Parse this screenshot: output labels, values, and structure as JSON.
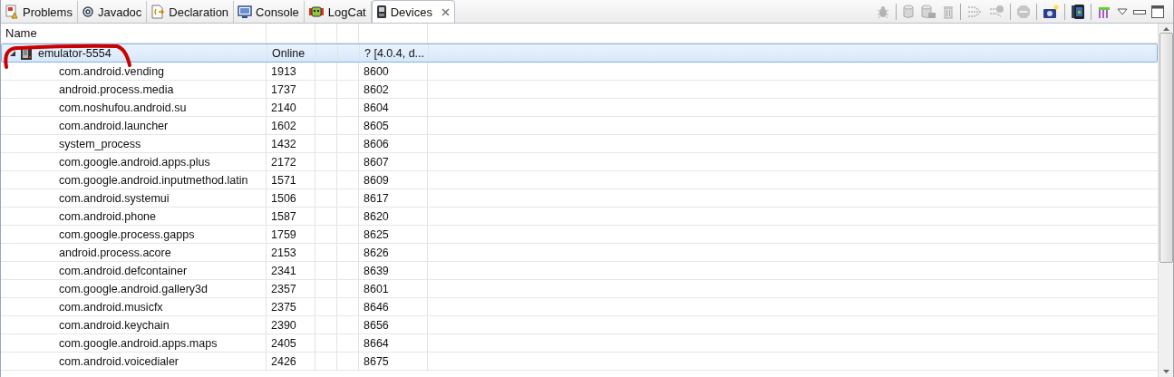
{
  "tabs": [
    {
      "label": "Problems",
      "kind": "problems",
      "selected": false
    },
    {
      "label": "Javadoc",
      "kind": "at",
      "selected": false
    },
    {
      "label": "Declaration",
      "kind": "declaration",
      "selected": false
    },
    {
      "label": "Console",
      "kind": "console",
      "selected": false
    },
    {
      "label": "LogCat",
      "kind": "logcat",
      "selected": false
    },
    {
      "label": "Devices",
      "kind": "phone",
      "selected": true
    }
  ],
  "toolbar": [
    {
      "kind": "bug",
      "disabled": true
    },
    {
      "kind": "sep"
    },
    {
      "kind": "heap",
      "disabled": true
    },
    {
      "kind": "dump",
      "disabled": true
    },
    {
      "kind": "gc",
      "disabled": true
    },
    {
      "kind": "sep"
    },
    {
      "kind": "threads",
      "disabled": true
    },
    {
      "kind": "alloc",
      "disabled": true
    },
    {
      "kind": "sep"
    },
    {
      "kind": "stop",
      "disabled": true
    },
    {
      "kind": "sep"
    },
    {
      "kind": "camera",
      "disabled": false
    },
    {
      "kind": "sep"
    },
    {
      "kind": "device",
      "disabled": false
    },
    {
      "kind": "sep"
    },
    {
      "kind": "trace",
      "disabled": false
    }
  ],
  "table": {
    "columns": [
      "Name"
    ],
    "device": {
      "name": "emulator-5554",
      "expanded": true,
      "selected": true,
      "status": "Online",
      "column_5": "? [4.0.4, d..."
    },
    "rows": [
      {
        "name": "com.android.vending",
        "pid": "1913",
        "port": "8600"
      },
      {
        "name": "android.process.media",
        "pid": "1737",
        "port": "8602"
      },
      {
        "name": "com.noshufou.android.su",
        "pid": "2140",
        "port": "8604"
      },
      {
        "name": "com.android.launcher",
        "pid": "1602",
        "port": "8605"
      },
      {
        "name": "system_process",
        "pid": "1432",
        "port": "8606"
      },
      {
        "name": "com.google.android.apps.plus",
        "pid": "2172",
        "port": "8607"
      },
      {
        "name": "com.google.android.inputmethod.latin",
        "pid": "1571",
        "port": "8609"
      },
      {
        "name": "com.android.systemui",
        "pid": "1506",
        "port": "8617"
      },
      {
        "name": "com.android.phone",
        "pid": "1587",
        "port": "8620"
      },
      {
        "name": "com.google.process.gapps",
        "pid": "1759",
        "port": "8625"
      },
      {
        "name": "android.process.acore",
        "pid": "2153",
        "port": "8626"
      },
      {
        "name": "com.android.defcontainer",
        "pid": "2341",
        "port": "8639"
      },
      {
        "name": "com.google.android.gallery3d",
        "pid": "2357",
        "port": "8601"
      },
      {
        "name": "com.android.musicfx",
        "pid": "2375",
        "port": "8646"
      },
      {
        "name": "com.android.keychain",
        "pid": "2390",
        "port": "8656"
      },
      {
        "name": "com.google.android.apps.maps",
        "pid": "2405",
        "port": "8664"
      },
      {
        "name": "com.android.voicedialer",
        "pid": "2426",
        "port": "8675"
      }
    ]
  }
}
